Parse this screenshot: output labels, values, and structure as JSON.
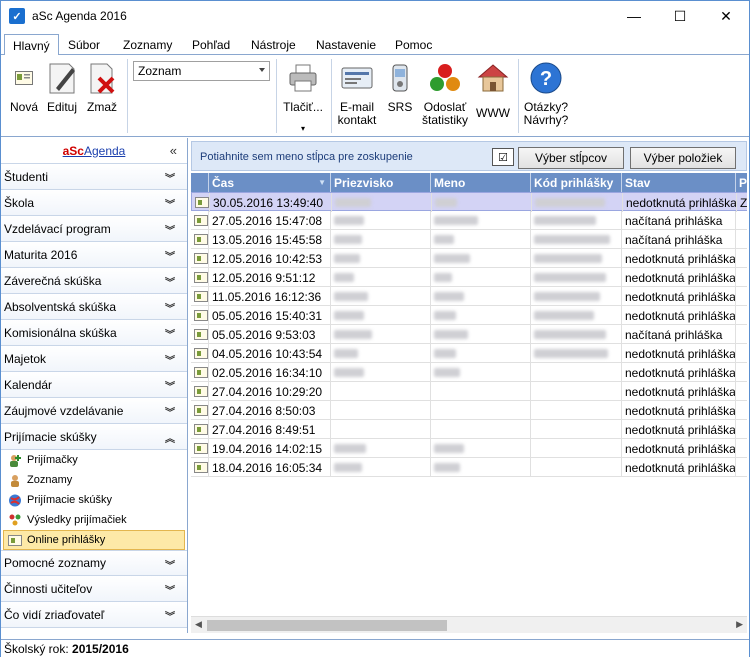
{
  "window": {
    "title": "aSc Agenda 2016",
    "minimize": "—",
    "maximize": "☐",
    "close": "✕"
  },
  "menu": {
    "tabs": [
      "Hlavný",
      "Súbor",
      "Zoznamy",
      "Pohľad",
      "Nástroje",
      "Nastavenie",
      "Pomoc"
    ],
    "active": "Hlavný"
  },
  "ribbon": {
    "new": "Nová",
    "edit": "Edituj",
    "delete": "Zmaž",
    "combo_value": "Zoznam",
    "print": "Tlačiť...",
    "email_1": "E-mail",
    "email_2": "kontakt",
    "srs": "SRS",
    "send_1": "Odoslať",
    "send_2": "štatistiky",
    "www": "WWW",
    "help_1": "Otázky?",
    "help_2": "Návrhy?"
  },
  "sidebar": {
    "brand_a": "aSc",
    "brand_b": "Agenda",
    "collapse": "«",
    "items_top": [
      "Študenti",
      "Škola",
      "Vzdelávací program",
      "Maturita 2016",
      "Záverečná skúška",
      "Absolventská skúška",
      "Komisionálna skúška",
      "Majetok",
      "Kalendár",
      "Záujmové vzdelávanie"
    ],
    "expanded": "Prijímacie skúšky",
    "sub_items": [
      "Prijímačky",
      "Zoznamy",
      "Prijímacie skúšky",
      "Výsledky prijímačiek",
      "Online prihlášky"
    ],
    "selected_sub": "Online prihlášky",
    "items_bottom": [
      "Pomocné zoznamy",
      "Činnosti učiteľov",
      "Čo vidí zriaďovateľ"
    ]
  },
  "toolbar": {
    "group_hint": "Potiahnite sem meno stĺpca pre zoskupenie",
    "check": "☑",
    "choose_columns": "Výber stĺpcov",
    "choose_items": "Výber položiek"
  },
  "grid": {
    "columns": [
      "Čas",
      "Priezvisko",
      "Meno",
      "Kód prihlášky",
      "Stav",
      "P"
    ],
    "rows": [
      {
        "time": "30.05.2016 13:49:40",
        "state": "nedotknutá prihláška",
        "extra": "Z"
      },
      {
        "time": "27.05.2016 15:47:08",
        "state": "načítaná prihláška",
        "extra": ""
      },
      {
        "time": "13.05.2016 15:45:58",
        "state": "načítaná prihláška",
        "extra": ""
      },
      {
        "time": "12.05.2016 10:42:53",
        "state": "nedotknutá prihláška",
        "extra": ""
      },
      {
        "time": "12.05.2016 9:51:12",
        "state": "nedotknutá prihláška",
        "extra": ""
      },
      {
        "time": "11.05.2016 16:12:36",
        "state": "nedotknutá prihláška",
        "extra": ""
      },
      {
        "time": "05.05.2016 15:40:31",
        "state": "nedotknutá prihláška",
        "extra": ""
      },
      {
        "time": "05.05.2016 9:53:03",
        "state": "načítaná prihláška",
        "extra": ""
      },
      {
        "time": "04.05.2016 10:43:54",
        "state": "nedotknutá prihláška",
        "extra": ""
      },
      {
        "time": "02.05.2016 16:34:10",
        "state": "nedotknutá prihláška",
        "extra": ""
      },
      {
        "time": "27.04.2016 10:29:20",
        "state": "nedotknutá prihláška",
        "extra": ""
      },
      {
        "time": "27.04.2016 8:50:03",
        "state": "nedotknutá prihláška",
        "extra": ""
      },
      {
        "time": "27.04.2016 8:49:51",
        "state": "nedotknutá prihláška",
        "extra": ""
      },
      {
        "time": "19.04.2016 14:02:15",
        "state": "nedotknutá prihláška",
        "extra": ""
      },
      {
        "time": "18.04.2016 16:05:34",
        "state": "nedotknutá prihláška",
        "extra": ""
      }
    ]
  },
  "status": {
    "label": "Školský rok:",
    "value": "2015/2016"
  }
}
